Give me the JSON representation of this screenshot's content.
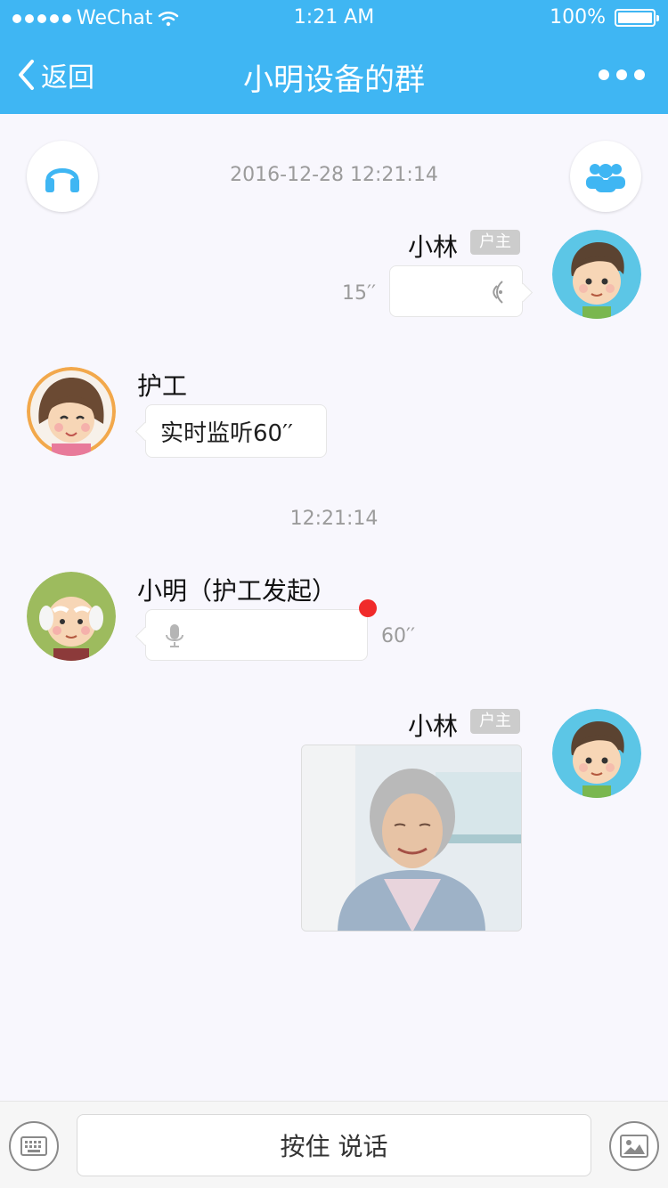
{
  "status": {
    "carrier": "WeChat",
    "time": "1:21 AM",
    "battery": "100%"
  },
  "nav": {
    "back_label": "返回",
    "title": "小明设备的群"
  },
  "top_actions": {
    "left_icon": "headphones-icon",
    "right_icon": "group-icon"
  },
  "messages": [
    {
      "timestamp": "2016-12-28 12:21:14",
      "sender": "小林",
      "role_badge": "户主",
      "duration": "15′′"
    },
    {
      "sender": "护工",
      "text": "实时监听60′′"
    },
    {
      "timestamp": "12:21:14"
    },
    {
      "sender": "小明（护工发起）",
      "duration": "60′′"
    },
    {
      "sender": "小林",
      "role_badge": "户主"
    }
  ],
  "bottom": {
    "hold_to_talk": "按住 说话",
    "keyboard_icon": "keyboard-icon",
    "image_icon": "image-icon"
  },
  "colors": {
    "brand_blue": "#3FB6F3",
    "unread_red": "#F02A2A"
  }
}
